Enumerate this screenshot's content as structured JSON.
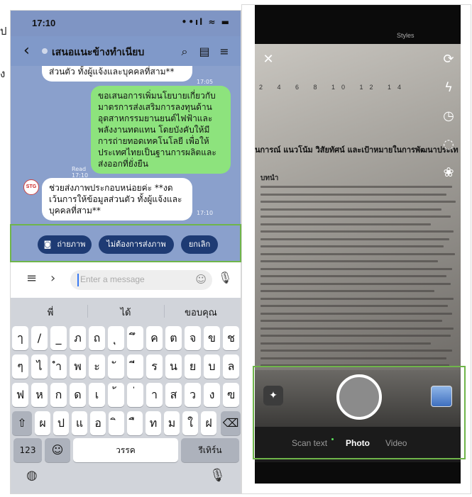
{
  "side_chars": [
    "ป",
    "ง"
  ],
  "left_phone": {
    "status": {
      "time": "17:10",
      "icons": "••ıl ≈ ▬"
    },
    "nav": {
      "back_glyph": "‹",
      "title": "เสนอแนะข้างทำเนียบ",
      "icon_search": "⌕",
      "icon_note": "▤",
      "icon_menu": "≡"
    },
    "chat": {
      "msg_top_partial": "ส่วนตัว ทั้งผู้แจ้งและบุคคลที่สาม**",
      "msg_top_time": "17:05",
      "msg_green": "ขอเสนอการเพิ่มนโยบายเกี่ยวกับมาตรการส่งเสริมการลงทุนด้านอุตสาหกรรมยานยนต์ไฟฟ้าและพลังงานทดแทน โดยบังคับให้มีการถ่ายทอดเทคโนโลยี เพื่อให้ประเทศไทยเป็นฐานการผลิตและส่งออกที่ยั่งยืน",
      "msg_green_read": "Read",
      "msg_green_time": "17:10",
      "bot_avatar": "STG",
      "msg_bot": "ช่วยส่งภาพประกอบหน่อยค่ะ **งดเว้นการให้ข้อมูลส่วนตัว ทั้งผู้แจ้งและบุคคลที่สาม**",
      "msg_bot_time": "17:10"
    },
    "quick_replies": {
      "camera_icon": "◙",
      "take_photo": "ถ่ายภาพ",
      "no_photo": "ไม่ต้องการส่งภาพ",
      "cancel": "ยกเลิก"
    },
    "input": {
      "menu_icon": "≡",
      "arrow_icon": "›",
      "placeholder": "Enter a message",
      "smile_icon": "☺",
      "mic_icon": "🎙"
    },
    "keyboard": {
      "suggestions": [
        "พี่",
        "ได้",
        "ขอบคุณ"
      ],
      "row1": [
        "ๅ",
        "/",
        "_",
        "ภ",
        "ถ",
        "ุ",
        "ึ",
        "ค",
        "ต",
        "จ",
        "ข",
        "ช"
      ],
      "row2": [
        "ๆ",
        "ไ",
        "ำ",
        "พ",
        "ะ",
        "ั",
        "ี",
        "ร",
        "น",
        "ย",
        "บ",
        "ล"
      ],
      "row3": [
        "ฟ",
        "ห",
        "ก",
        "ด",
        "เ",
        "้",
        "่",
        "า",
        "ส",
        "ว",
        "ง",
        "ฃ"
      ],
      "row4_shift": "⇧",
      "row4": [
        "ผ",
        "ป",
        "แ",
        "อ",
        "ิ",
        "ื",
        "ท",
        "ม",
        "ใ",
        "ฝ"
      ],
      "row4_delete": "⌫",
      "key_123": "123",
      "key_emoji": "☺",
      "key_space": "วรรค",
      "key_return": "รีเทิร์น",
      "globe_icon": "◍",
      "mic_icon": "🎙"
    }
  },
  "right_phone": {
    "styles_label": "Styles",
    "ruler": "2  4  6  8  10  12  14",
    "doc_title": "นการณ์ แนวโน้ม วิสัยทัศน์ และเป้าหมายในการพัฒนาประเท",
    "doc_heading": "บทนำ",
    "icons": {
      "close": "✕",
      "rotate": "⟳",
      "flash": "ϟ",
      "timer": "◷",
      "circle": "◌",
      "filter": "❀",
      "sparkle": "✦"
    },
    "modes": {
      "scan": "Scan text",
      "photo": "Photo",
      "video": "Video"
    }
  }
}
